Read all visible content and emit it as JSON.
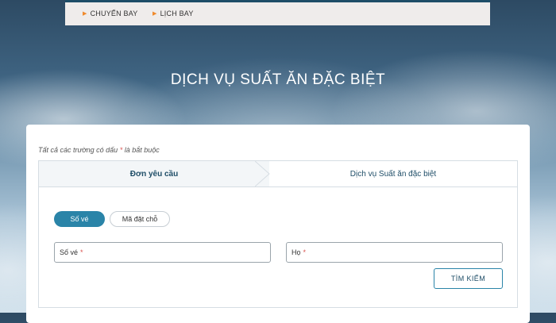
{
  "nav": {
    "items": [
      {
        "label": "CHUYẾN BAY"
      },
      {
        "label": "LỊCH BAY"
      }
    ]
  },
  "hero": {
    "title": "DỊCH VỤ SUẤT ĂN ĐẶC BIỆT"
  },
  "form": {
    "required_note_prefix": "Tất cả các trường có dấu",
    "required_star": "*",
    "required_note_suffix": "là bắt buộc",
    "steps": [
      {
        "label": "Đơn yêu cầu",
        "active": true
      },
      {
        "label": "Dịch vụ Suất ăn đặc biệt",
        "active": false
      }
    ],
    "toggles": [
      {
        "label": "Số vé",
        "selected": true
      },
      {
        "label": "Mã đặt chỗ",
        "selected": false
      }
    ],
    "fields": {
      "ticket_label": "Số vé",
      "surname_label": "Họ",
      "required_star": "*"
    },
    "search_button": "TÌM KIẾM"
  },
  "colors": {
    "accent": "#2a84a8",
    "dark_blue": "#1e4d67",
    "nav_arrow": "#f0892b",
    "required": "#d9534f"
  }
}
